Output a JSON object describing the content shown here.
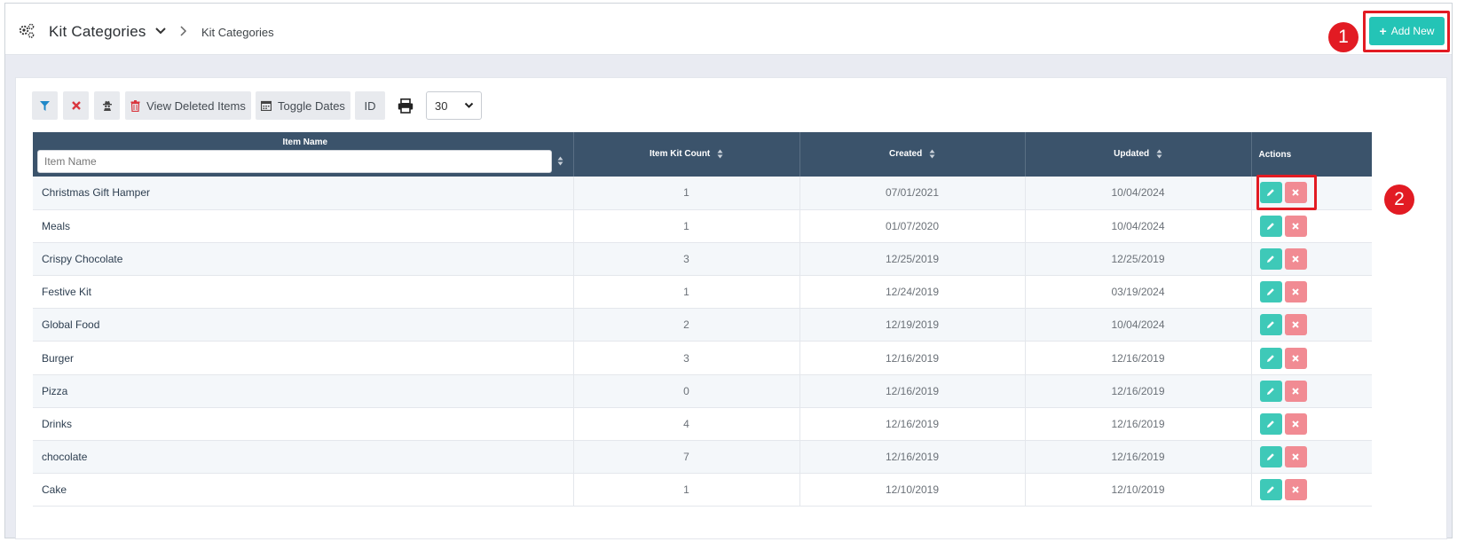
{
  "header": {
    "title": "Kit Categories",
    "breadcrumb": "Kit Categories",
    "add_button_label": "Add New"
  },
  "annotations": {
    "badge_1": "1",
    "badge_2": "2"
  },
  "toolbar": {
    "view_deleted_label": "View Deleted Items",
    "toggle_dates_label": "Toggle Dates",
    "id_label": "ID",
    "page_size_value": "30"
  },
  "table": {
    "columns": {
      "item_name": "Item Name",
      "item_kit_count": "Item Kit Count",
      "created": "Created",
      "updated": "Updated",
      "actions": "Actions"
    },
    "name_filter_placeholder": "Item Name",
    "rows": [
      {
        "name": "Christmas Gift Hamper",
        "count": "1",
        "created": "07/01/2021",
        "updated": "10/04/2024"
      },
      {
        "name": "Meals",
        "count": "1",
        "created": "01/07/2020",
        "updated": "10/04/2024"
      },
      {
        "name": "Crispy Chocolate",
        "count": "3",
        "created": "12/25/2019",
        "updated": "12/25/2019"
      },
      {
        "name": "Festive Kit",
        "count": "1",
        "created": "12/24/2019",
        "updated": "03/19/2024"
      },
      {
        "name": "Global Food",
        "count": "2",
        "created": "12/19/2019",
        "updated": "10/04/2024"
      },
      {
        "name": "Burger",
        "count": "3",
        "created": "12/16/2019",
        "updated": "12/16/2019"
      },
      {
        "name": "Pizza",
        "count": "0",
        "created": "12/16/2019",
        "updated": "12/16/2019"
      },
      {
        "name": "Drinks",
        "count": "4",
        "created": "12/16/2019",
        "updated": "12/16/2019"
      },
      {
        "name": "chocolate",
        "count": "7",
        "created": "12/16/2019",
        "updated": "12/16/2019"
      },
      {
        "name": "Cake",
        "count": "1",
        "created": "12/10/2019",
        "updated": "12/10/2019"
      }
    ]
  },
  "colors": {
    "accent": "#24c4b6",
    "header_row": "#3b536b",
    "delete": "#f18b93",
    "highlight": "#e21b23"
  }
}
